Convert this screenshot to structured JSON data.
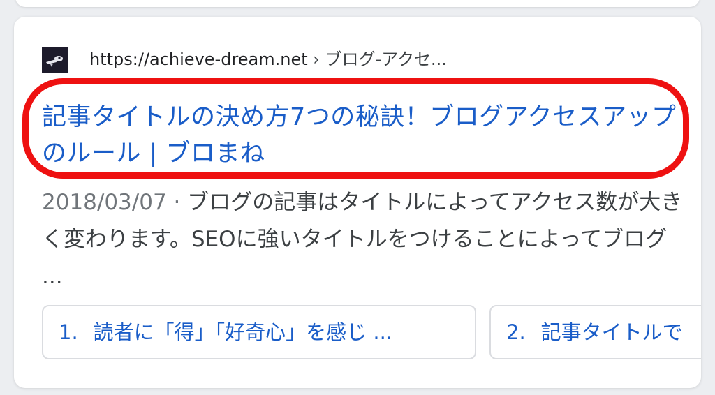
{
  "result": {
    "url": "https://achieve-dream.net",
    "breadcrumb_separator": "›",
    "breadcrumb": "ブログ-アクセ...",
    "favicon": "site-favicon-icon",
    "title": "記事タイトルの決め方7つの秘訣！ブログアクセスアップのルール | ブロまね",
    "date": "2018/03/07",
    "date_separator": "·",
    "snippet": "ブログの記事はタイトルによってアクセス数が大きく変わります。SEOに強いタイトルをつけることによってブログ ...",
    "highlight_color": "#ee1111",
    "link_color": "#1a5dc8"
  },
  "sitelinks": [
    {
      "number": "1.",
      "label": "読者に「得」「好奇心」を感じ ..."
    },
    {
      "number": "2.",
      "label": "記事タイトルで"
    }
  ]
}
